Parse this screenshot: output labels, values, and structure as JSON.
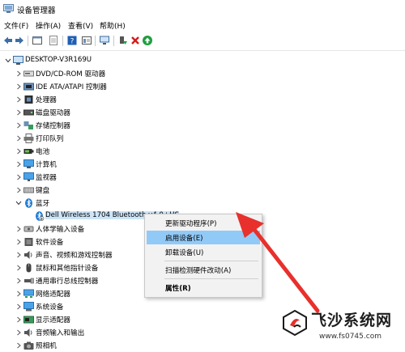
{
  "window": {
    "title": "设备管理器"
  },
  "menu": [
    "文件(F)",
    "操作(A)",
    "查看(V)",
    "帮助(H)"
  ],
  "tree": {
    "root": "DESKTOP-V3R169U",
    "categories": [
      {
        "label": "DVD/CD-ROM 驱动器",
        "icon": "dvd-drive-icon"
      },
      {
        "label": "IDE ATA/ATAPI 控制器",
        "icon": "ide-controller-icon"
      },
      {
        "label": "处理器",
        "icon": "processor-icon"
      },
      {
        "label": "磁盘驱动器",
        "icon": "disk-drive-icon"
      },
      {
        "label": "存储控制器",
        "icon": "storage-controller-icon"
      },
      {
        "label": "打印队列",
        "icon": "printer-icon"
      },
      {
        "label": "电池",
        "icon": "battery-icon"
      },
      {
        "label": "计算机",
        "icon": "computer-icon"
      },
      {
        "label": "监视器",
        "icon": "monitor-icon"
      },
      {
        "label": "键盘",
        "icon": "keyboard-icon"
      },
      {
        "label": "蓝牙",
        "icon": "bluetooth-icon"
      },
      {
        "label": "Dell Wireless 1704 Bluetooth v4.0+HS",
        "icon": "bluetooth-device-disabled-icon"
      },
      {
        "label": "人体学输入设备",
        "icon": "hid-icon"
      },
      {
        "label": "软件设备",
        "icon": "software-device-icon"
      },
      {
        "label": "声音、视频和游戏控制器",
        "icon": "sound-icon"
      },
      {
        "label": "鼠标和其他指针设备",
        "icon": "mouse-icon"
      },
      {
        "label": "通用串行总线控制器",
        "icon": "usb-icon"
      },
      {
        "label": "网络适配器",
        "icon": "network-icon"
      },
      {
        "label": "系统设备",
        "icon": "system-device-icon"
      },
      {
        "label": "显示适配器",
        "icon": "display-adapter-icon"
      },
      {
        "label": "音频输入和输出",
        "icon": "audio-io-icon"
      },
      {
        "label": "照相机",
        "icon": "camera-icon"
      }
    ]
  },
  "context_menu": {
    "items": [
      "更新驱动程序(P)",
      "启用设备(E)",
      "卸载设备(U)",
      "扫描检测硬件改动(A)",
      "属性(R)"
    ]
  },
  "watermark": {
    "brand": "飞沙系统网",
    "url": "www.fs0745.com"
  },
  "colors": {
    "highlight": "#91c9f7",
    "selection": "#cce4f7",
    "arrow": "#e8302c"
  }
}
